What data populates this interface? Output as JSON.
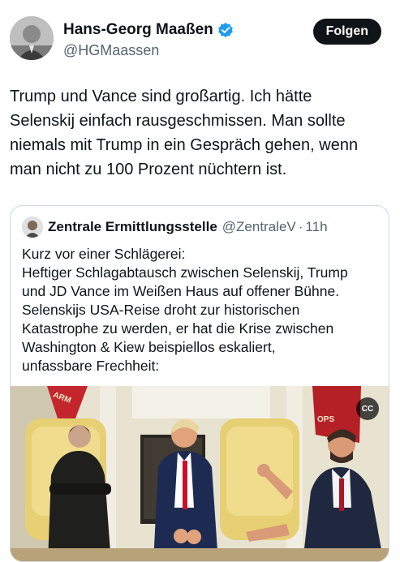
{
  "author": {
    "display_name": "Hans-Georg Maaßen",
    "handle": "@HGMaassen",
    "verified_icon": "verified-badge-icon",
    "follow_label": "Folgen"
  },
  "tweet": {
    "text": "Trump und Vance sind großartig. Ich hätte\nSelenskij einfach rausgeschmissen. Man sollte\nniemals mit Trump in ein Gespräch gehen, wenn\nman nicht zu 100 Prozent nüchtern ist."
  },
  "quote": {
    "display_name": "Zentrale Ermittlungsstelle",
    "handle": "@ZentraleV",
    "separator": "·",
    "time": "11h",
    "text": "Kurz vor einer Schlägerei:\nHeftiger Schlagabtausch zwischen Selenskij, Trump\nund JD Vance im Weißen Haus auf offener Bühne.\nSelenskijs USA-Reise droht zur historischen\nKatastrophe zu werden, er hat die Krise zwischen\nWashington & Kiew beispiellos eskaliert,\nunfassbare Frechheit:",
    "media": {
      "cc_label": "CC",
      "flag_text": "ARM",
      "flag_text_right": "OPS"
    }
  },
  "colors": {
    "text": "#0f1419",
    "muted": "#536471",
    "verified": "#1d9bf0",
    "button": "#0f1419",
    "border": "#cfd9de"
  }
}
